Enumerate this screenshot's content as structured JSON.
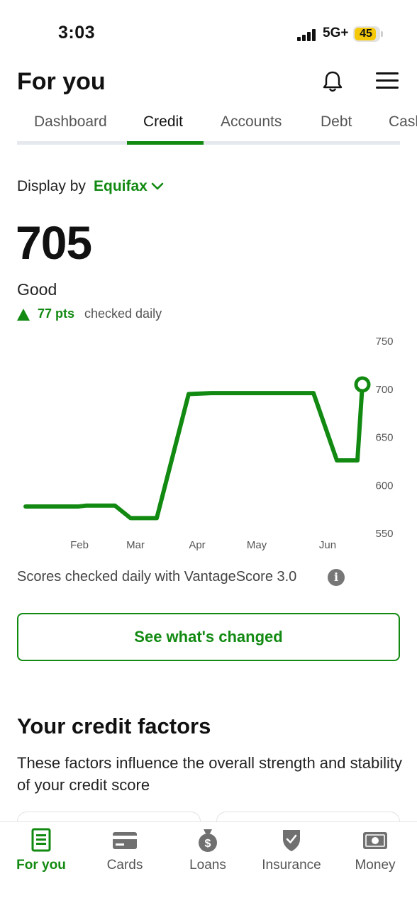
{
  "status_bar": {
    "time": "3:03",
    "network": "5G+",
    "battery": "45"
  },
  "header": {
    "title": "For you",
    "icons": [
      "bell-icon",
      "menu-icon"
    ]
  },
  "tabs": [
    {
      "label": "Dashboard",
      "active": false
    },
    {
      "label": "Credit",
      "active": true
    },
    {
      "label": "Accounts",
      "active": false
    },
    {
      "label": "Debt",
      "active": false
    },
    {
      "label": "Cash",
      "active": false
    }
  ],
  "display_by": {
    "label": "Display by",
    "bureau": "Equifax"
  },
  "score": {
    "value": "705",
    "rating": "Good",
    "change": "77 pts",
    "note": "checked daily"
  },
  "chart_data": {
    "type": "line",
    "x_labels": [
      "Feb",
      "Mar",
      "Apr",
      "May",
      "Jun"
    ],
    "y_ticks": [
      "750",
      "700",
      "650",
      "600",
      "550"
    ],
    "ylim": [
      550,
      750
    ],
    "series": [
      {
        "x": [
          "Jan 20",
          "Feb 1",
          "Feb 10",
          "Feb 25",
          "Mar 1",
          "Mar 10",
          "Mar 25",
          "Apr 1",
          "Apr 15",
          "May 1",
          "May 15",
          "May 30",
          "Jun 5",
          "Jun 12",
          "Jun 13"
        ],
        "values": [
          578,
          578,
          579,
          579,
          566,
          566,
          695,
          696,
          696,
          696,
          696,
          626,
          626,
          705,
          705
        ]
      }
    ],
    "color": "#128a12",
    "grid": false
  },
  "footnote": "Scores checked daily with VantageScore 3.0",
  "cta_label": "See what's changed",
  "factors": {
    "title": "Your credit factors",
    "description": "These factors influence the overall strength and stability of your credit score"
  },
  "bottom_nav": [
    {
      "label": "For you",
      "icon": "document-icon",
      "active": true
    },
    {
      "label": "Cards",
      "icon": "credit-card-icon",
      "active": false
    },
    {
      "label": "Loans",
      "icon": "money-bag-icon",
      "active": false
    },
    {
      "label": "Insurance",
      "icon": "shield-check-icon",
      "active": false
    },
    {
      "label": "Money",
      "icon": "cash-icon",
      "active": false
    }
  ],
  "colors": {
    "accent": "#128a12",
    "battery": "#f5c90a"
  }
}
